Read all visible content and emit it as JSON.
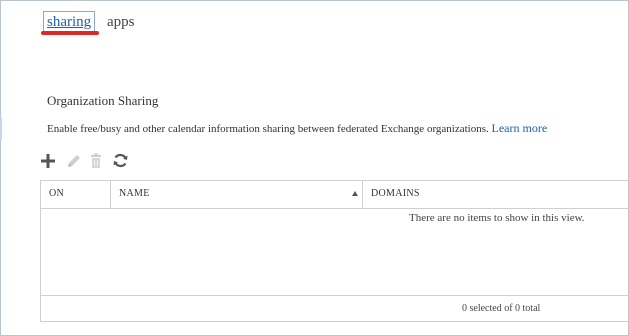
{
  "tabs": [
    {
      "label": "sharing",
      "active": true
    },
    {
      "label": "apps",
      "active": false
    }
  ],
  "section": {
    "title": "Organization Sharing",
    "description": "Enable free/busy and other calendar information sharing between federated Exchange organizations.",
    "learn_more": "Learn more"
  },
  "toolbar": {
    "icons": [
      "add-icon",
      "edit-icon",
      "delete-icon",
      "refresh-icon"
    ]
  },
  "grid": {
    "columns": [
      "ON",
      "NAME",
      "DOMAINS"
    ],
    "empty_message": "There are no items to show in this view.",
    "footer": "0 selected of 0 total"
  },
  "colors": {
    "accent": "#1f5fb0",
    "highlight": "#e02828"
  }
}
